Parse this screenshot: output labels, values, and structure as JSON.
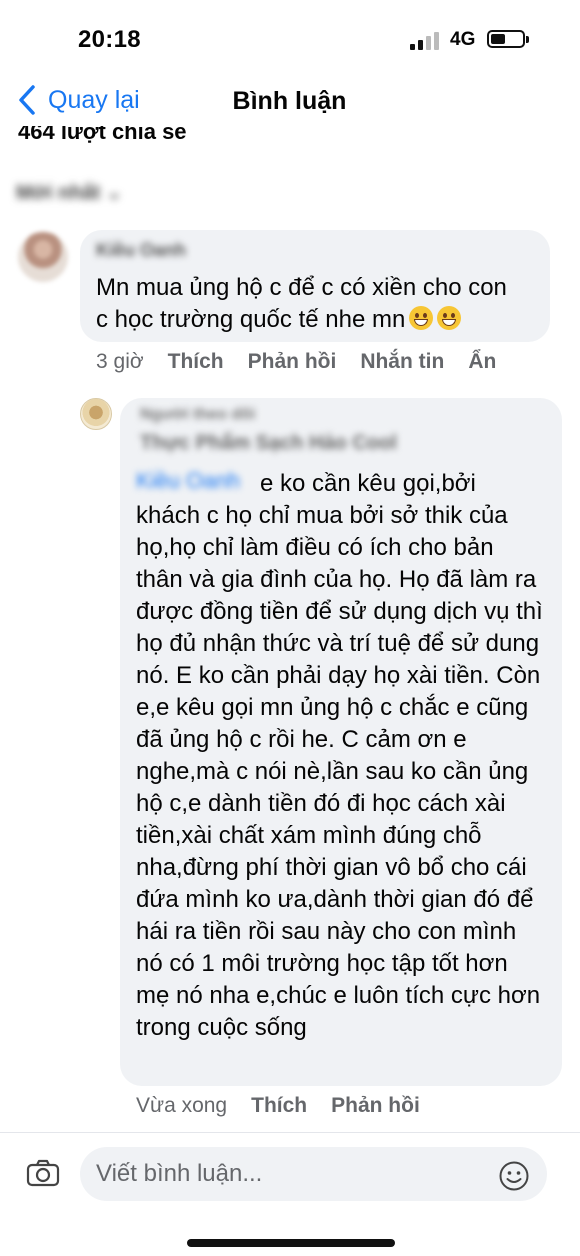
{
  "status_bar": {
    "time": "20:18",
    "network": "4G",
    "battery_icon": "battery-icon",
    "signal_icon": "signal-icon"
  },
  "nav": {
    "back_label": "Quay lại",
    "title": "Bình luận"
  },
  "shares_text": "464 lượt chia sẻ",
  "sort_label": "Mới nhất",
  "comments": [
    {
      "author": "Kiều Oanh",
      "text": "Mn mua ủng hộ c để c có xiền cho con\nc học trường quốc tế nhe mn",
      "time": "3 giờ",
      "actions": [
        "Thích",
        "Phản hồi",
        "Nhắn tin",
        "Ẩn"
      ]
    }
  ],
  "reply": {
    "author_badge": "Người theo dõi",
    "author": "Thực Phẩm Sạch Hảo Cool",
    "mention": "Kiều Oanh",
    "text": "e ko cần kêu gọi,bởi khách c họ chỉ mua bởi sở thik của họ,họ chỉ làm điều có ích cho bản thân và gia đình của họ. Họ đã làm ra được đồng tiền để sử dụng dịch vụ thì họ đủ nhận thức và trí tuệ để sử dung nó. E ko cần phải dạy họ xài tiền. Còn e,e kêu gọi mn ủng hộ c chắc e cũng đã ủng hộ c rồi he. C cảm ơn e nghe,mà c nói nè,lần sau ko cần ủng hộ c,e dành tiền đó đi học cách xài tiền,xài chất xám mình đúng chỗ nha,đừng phí thời gian vô bổ cho cái đứa mình ko ưa,dành thời gian đó để hái ra tiền rồi sau này cho con mình nó có 1 môi trường học tập tốt hơn mẹ nó nha e,chúc e luôn tích cực hơn trong cuộc sống",
    "time": "Vừa xong",
    "actions": [
      "Thích",
      "Phản hồi"
    ]
  },
  "composer": {
    "placeholder": "Viết bình luận...",
    "camera_icon": "camera-icon",
    "emoji_icon": "smiley-icon"
  },
  "colors": {
    "accent": "#1877f2",
    "bubble": "#f0f2f5",
    "muted": "#65676b"
  }
}
